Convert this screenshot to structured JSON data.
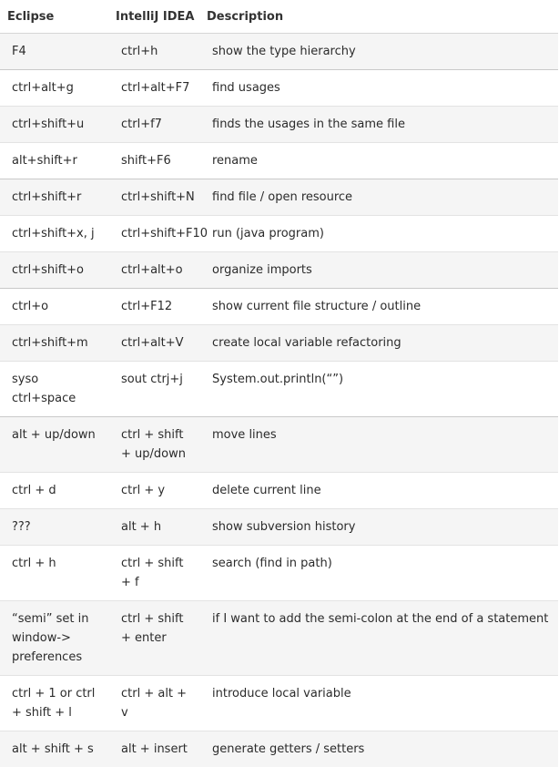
{
  "headers": {
    "eclipse": "Eclipse",
    "idea": "IntelliJ IDEA",
    "description": "Description"
  },
  "rows": [
    {
      "eclipse": "F4",
      "idea": "ctrl+h",
      "description": "show the type hierarchy"
    },
    {
      "eclipse": "ctrl+alt+g",
      "idea": "ctrl+alt+F7",
      "description": "find usages"
    },
    {
      "eclipse": "ctrl+shift+u",
      "idea": "ctrl+f7",
      "description": "finds the usages in the same file"
    },
    {
      "eclipse": "alt+shift+r",
      "idea": "shift+F6",
      "description": "rename"
    },
    {
      "eclipse": "ctrl+shift+r",
      "idea": "ctrl+shift+N",
      "description": "find file / open resource"
    },
    {
      "eclipse": "ctrl+shift+x, j",
      "idea": "ctrl+shift+F10",
      "description": "run (java program)"
    },
    {
      "eclipse": "ctrl+shift+o",
      "idea": "ctrl+alt+o",
      "description": "organize imports"
    },
    {
      "eclipse": "ctrl+o",
      "idea": "ctrl+F12",
      "description": "show current file structure / outline"
    },
    {
      "eclipse": "ctrl+shift+m",
      "idea": "ctrl+alt+V",
      "description": "create local variable refactoring"
    },
    {
      "eclipse": "syso ctrl+space",
      "idea": "sout ctrj+j",
      "description": "System.out.println(“”)"
    },
    {
      "eclipse": "alt + up/down",
      "idea": "ctrl + shift + up/down",
      "description": "move lines"
    },
    {
      "eclipse": "ctrl + d",
      "idea": "ctrl + y",
      "description": "delete current line"
    },
    {
      "eclipse": "???",
      "idea": "alt + h",
      "description": "show subversion history"
    },
    {
      "eclipse": "ctrl + h",
      "idea": "ctrl + shift + f",
      "description": "search (find in path)"
    },
    {
      "eclipse": "“semi” set in window-> preferences",
      "idea": "ctrl + shift + enter",
      "description": "if I want to add the semi-colon at the end of a statement"
    },
    {
      "eclipse": "ctrl + 1 or ctrl + shift + l",
      "idea": "ctrl + alt + v",
      "description": "introduce local variable"
    },
    {
      "eclipse": "alt + shift + s",
      "idea": "alt + insert",
      "description": "generate getters / setters"
    }
  ]
}
